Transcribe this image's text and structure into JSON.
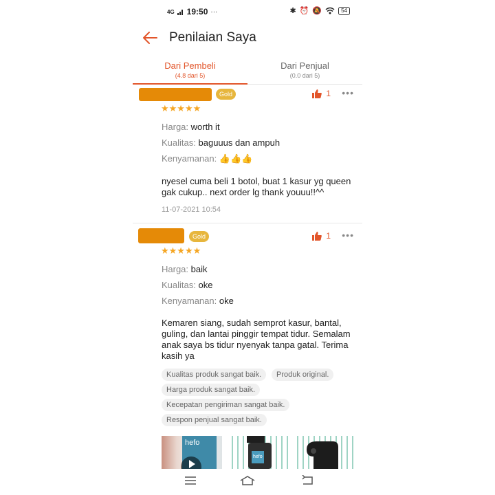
{
  "status_bar": {
    "time": "19:50",
    "signal": "4G",
    "battery": "54"
  },
  "header": {
    "title": "Penilaian Saya"
  },
  "tabs": [
    {
      "label": "Dari Pembeli",
      "sub": "(4.8 dari 5)"
    },
    {
      "label": "Dari Penjual",
      "sub": "(0.0 dari 5)"
    }
  ],
  "reviews": [
    {
      "badge": "Gold",
      "likes": "1",
      "stars": "★★★★★",
      "harga_label": "Harga:",
      "harga": "worth it",
      "kualitas_label": "Kualitas:",
      "kualitas": "baguuus dan ampuh",
      "kenyamanan_label": "Kenyamanan:",
      "kenyamanan": "👍👍👍",
      "text": "nyesel cuma beli 1 botol, buat 1 kasur yg queen gak cukup.. next order lg thank youuu!!^^",
      "date": "11-07-2021 10:54"
    },
    {
      "badge": "Gold",
      "likes": "1",
      "stars": "★★★★★",
      "harga_label": "Harga:",
      "harga": "baik",
      "kualitas_label": "Kualitas:",
      "kualitas": "oke",
      "kenyamanan_label": "Kenyamanan:",
      "kenyamanan": "oke",
      "text": "Kemaren siang, sudah semprot kasur, bantal, guling, dan lantai pinggir tempat tidur. Semalam anak saya bs tidur nyenyak tanpa gatal. Terima kasih ya",
      "tags": [
        "Kualitas produk sangat baik.",
        "Produk original.",
        "Harga produk sangat baik.",
        "Kecepatan pengiriman sangat baik.",
        "Respon penjual sangat baik."
      ],
      "photos": [
        {
          "label": "hefo"
        },
        {
          "label": "hefo"
        },
        {
          "label": ""
        }
      ]
    }
  ],
  "colors": {
    "accent": "#e2552a",
    "star": "#f5a623",
    "gold_badge": "#e7b63d",
    "name_redaction": "#e58a07"
  }
}
